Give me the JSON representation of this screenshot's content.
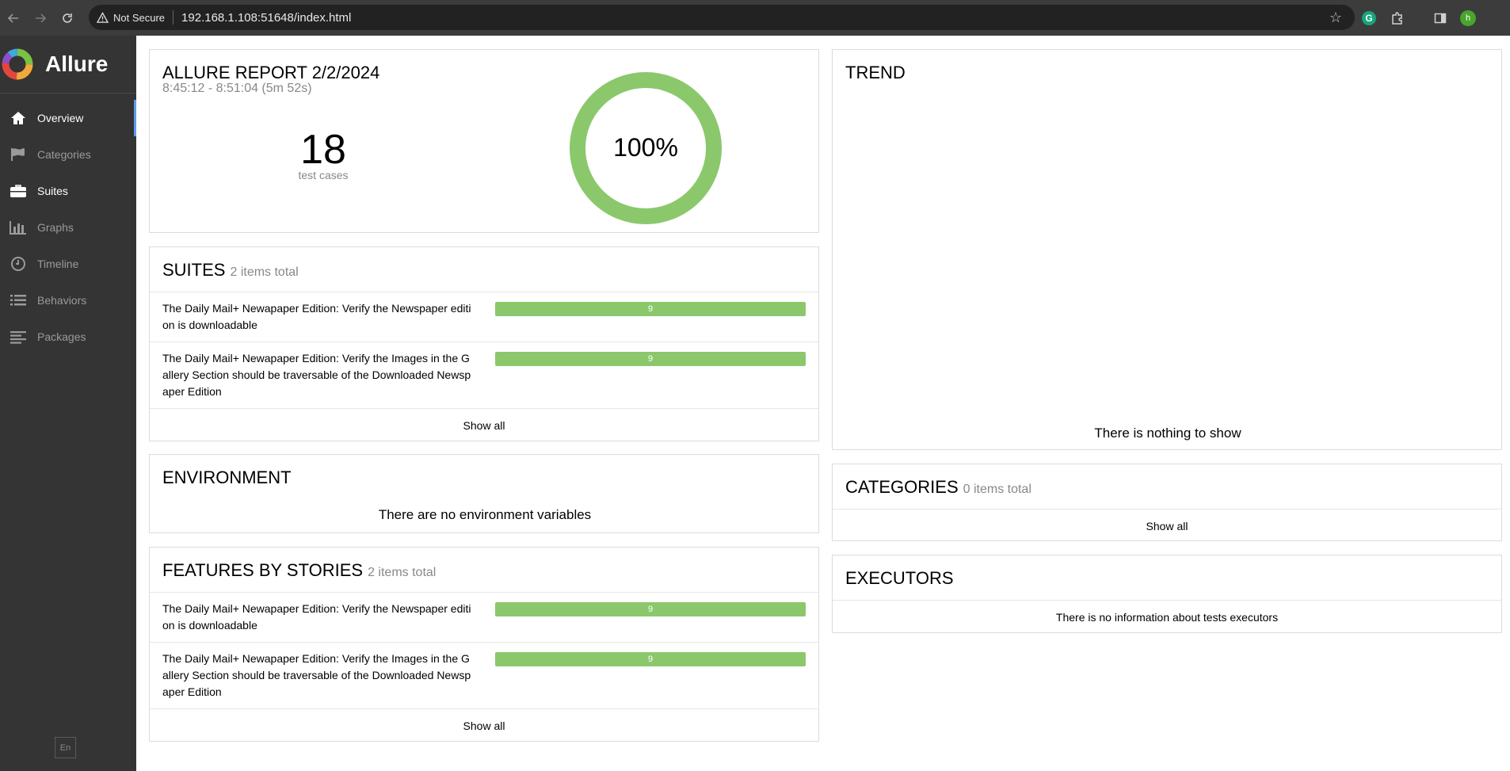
{
  "browser": {
    "security_label": "Not Secure",
    "url": "192.168.1.108:51648/index.html",
    "profile_initial": "h",
    "grammarly_letter": "G"
  },
  "sidebar": {
    "brand": "Allure",
    "items": [
      {
        "label": "Overview",
        "icon": "home-icon"
      },
      {
        "label": "Categories",
        "icon": "flag-icon"
      },
      {
        "label": "Suites",
        "icon": "briefcase-icon"
      },
      {
        "label": "Graphs",
        "icon": "bar-chart-icon"
      },
      {
        "label": "Timeline",
        "icon": "clock-icon"
      },
      {
        "label": "Behaviors",
        "icon": "list-icon"
      },
      {
        "label": "Packages",
        "icon": "align-left-icon"
      }
    ],
    "language": "En"
  },
  "summary": {
    "title": "ALLURE REPORT 2/2/2024",
    "time": "8:45:12 - 8:51:04 (5m 52s)",
    "count": "18",
    "count_label": "test cases",
    "percent": "100%",
    "passed_fraction": 1.0
  },
  "suites": {
    "title": "SUITES",
    "subtitle": "2 items total",
    "rows": [
      {
        "name": "The Daily Mail+ Newapaper Edition: Verify the Newspaper editi on is downloadable",
        "value": "9"
      },
      {
        "name": "The Daily Mail+ Newapaper Edition: Verify the Images in the G allery Section should be traversable of the Downloaded Newsp aper Edition",
        "value": "9"
      }
    ],
    "show_all": "Show all"
  },
  "environment": {
    "title": "ENVIRONMENT",
    "empty": "There are no environment variables"
  },
  "features": {
    "title": "FEATURES BY STORIES",
    "subtitle": "2 items total",
    "rows": [
      {
        "name": "The Daily Mail+ Newapaper Edition: Verify the Newspaper editi on is downloadable",
        "value": "9"
      },
      {
        "name": "The Daily Mail+ Newapaper Edition: Verify the Images in the G allery Section should be traversable of the Downloaded Newsp aper Edition",
        "value": "9"
      }
    ],
    "show_all": "Show all"
  },
  "trend": {
    "title": "TREND",
    "empty": "There is nothing to show"
  },
  "categories": {
    "title": "CATEGORIES",
    "subtitle": "0 items total",
    "show_all": "Show all"
  },
  "executors": {
    "title": "EXECUTORS",
    "empty": "There is no information about tests executors"
  },
  "colors": {
    "passed": "#8bc86c",
    "sidebar": "#343434",
    "active_indicator": "#5d9cec"
  }
}
